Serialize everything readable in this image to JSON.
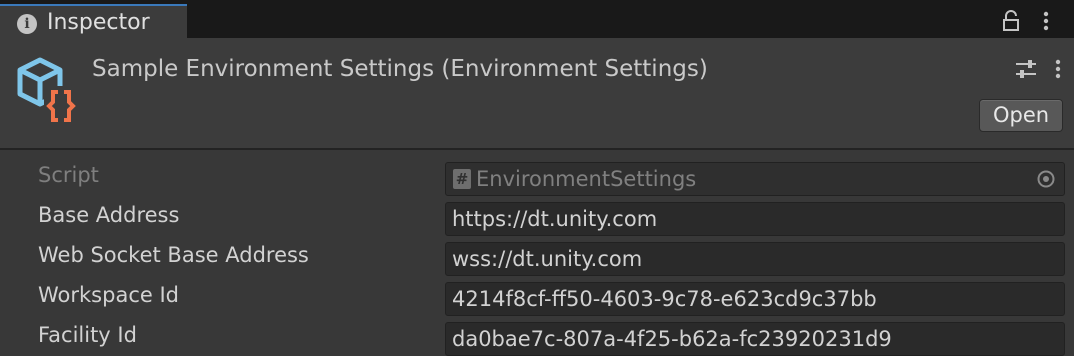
{
  "tab": {
    "label": "Inspector",
    "icon": "info-icon"
  },
  "header": {
    "title": "Sample Environment Settings (Environment Settings)",
    "open_button": "Open",
    "icon": "scriptable-object-icon",
    "icon_colors": {
      "cube": "#7fc6ea",
      "braces": "#f0744a"
    }
  },
  "properties": {
    "script": {
      "label": "Script",
      "value": "EnvironmentSettings"
    },
    "base_address": {
      "label": "Base Address",
      "value": "https://dt.unity.com"
    },
    "web_socket_base_address": {
      "label": "Web Socket Base Address",
      "value": "wss://dt.unity.com"
    },
    "workspace_id": {
      "label": "Workspace Id",
      "value": "4214f8cf-ff50-4603-9c78-e623cd9c37bb"
    },
    "facility_id": {
      "label": "Facility Id",
      "value": "da0bae7c-807a-4f25-b62a-fc23920231d9"
    }
  },
  "colors": {
    "accent": "#3a79bb",
    "background": "#383838",
    "field": "#2a2a2a"
  }
}
